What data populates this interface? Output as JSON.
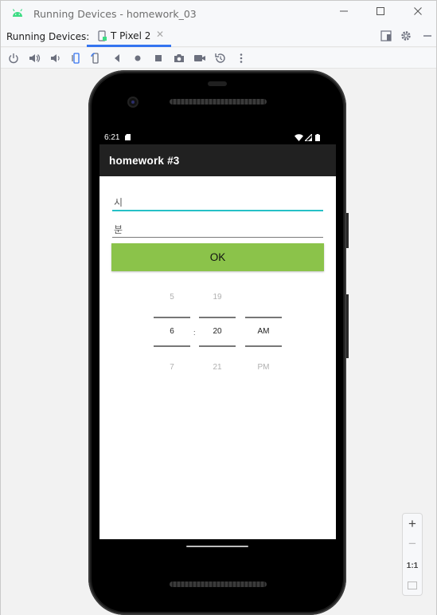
{
  "window": {
    "title": "Running Devices - homework_03"
  },
  "tabs": {
    "label": "Running Devices:",
    "items": [
      {
        "label": "T Pixel 2"
      }
    ]
  },
  "device": {
    "status": {
      "time": "6:21"
    },
    "app_title": "homework #3",
    "fields": {
      "hour_hint": "시",
      "minute_hint": "분"
    },
    "ok_label": "OK",
    "picker": {
      "hour": {
        "prev": "5",
        "selected": "6",
        "next": "7"
      },
      "minute": {
        "prev": "19",
        "selected": "20",
        "next": "21"
      },
      "ampm": {
        "prev": "",
        "selected": "AM",
        "next": "PM"
      },
      "separator": ":"
    }
  },
  "zoom": {
    "plus": "+",
    "minus": "−",
    "actual": "1:1"
  },
  "colors": {
    "accent": "#26c0c6",
    "button": "#8bc34a",
    "appbar": "#212121",
    "tab_underline": "#3574f0"
  }
}
